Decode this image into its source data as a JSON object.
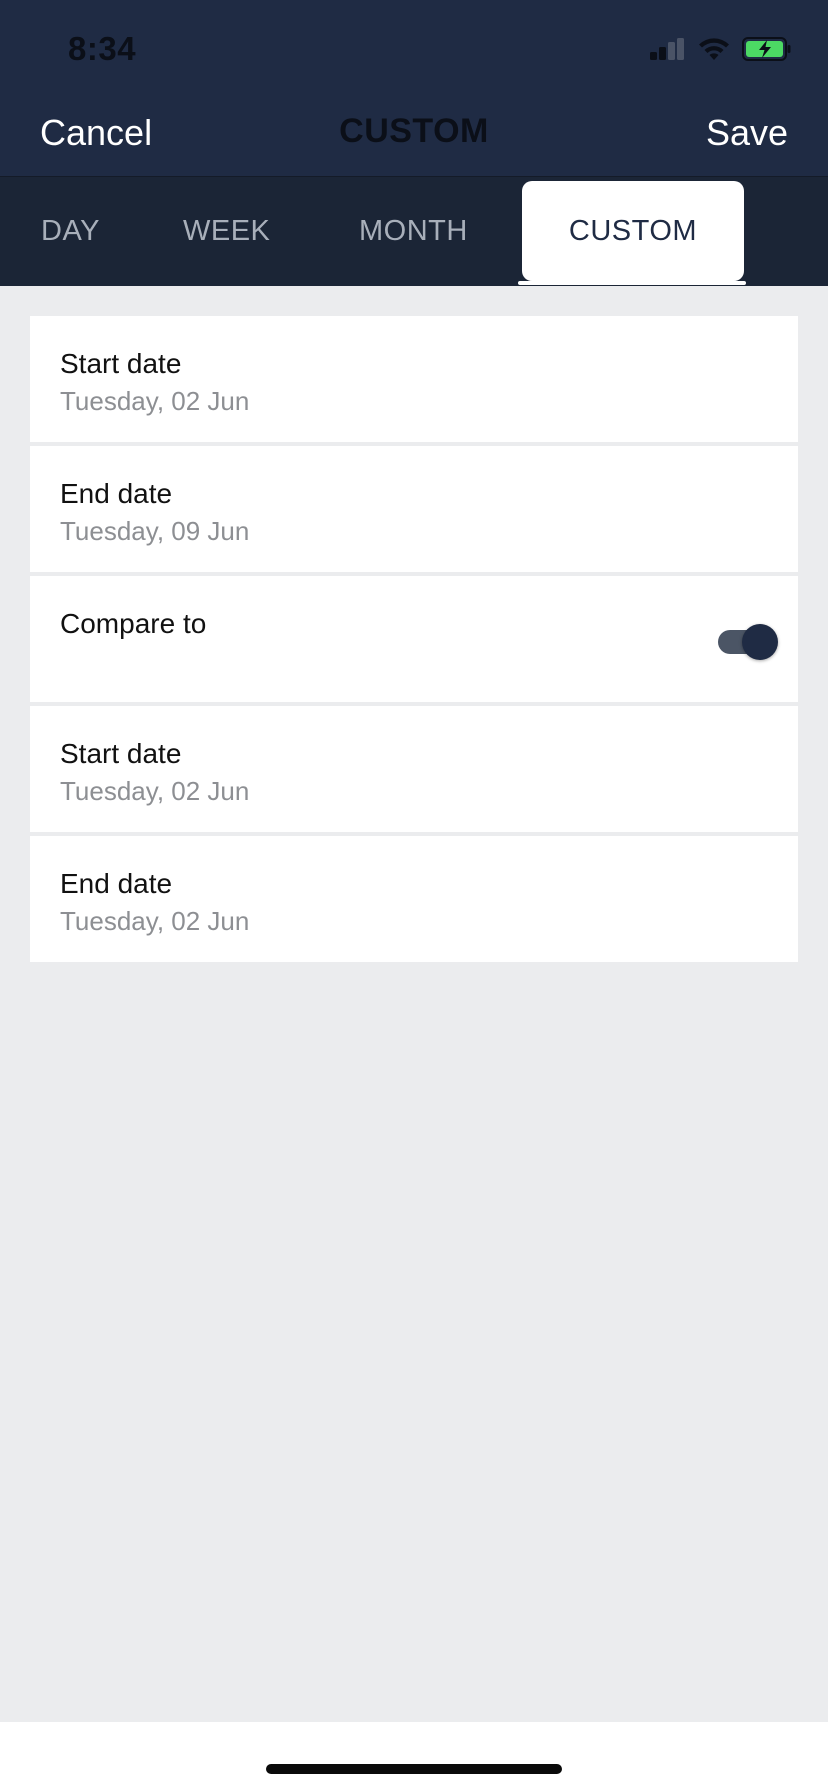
{
  "status": {
    "time": "8:34"
  },
  "nav": {
    "cancel_label": "Cancel",
    "title": "CUSTOM",
    "save_label": "Save"
  },
  "tabs": [
    {
      "label": "DAY",
      "selected": false
    },
    {
      "label": "WEEK",
      "selected": false
    },
    {
      "label": "MONTH",
      "selected": false
    },
    {
      "label": "CUSTOM",
      "selected": true
    }
  ],
  "rows": [
    {
      "title": "Start date",
      "value": "Tuesday, 02 Jun"
    },
    {
      "title": "End date",
      "value": "Tuesday, 09 Jun"
    },
    {
      "title": "Compare to",
      "toggle_on": true
    },
    {
      "title": "Start date",
      "value": "Tuesday, 02 Jun"
    },
    {
      "title": "End date",
      "value": "Tuesday, 02 Jun"
    }
  ],
  "colors": {
    "header_bg": "#1f2b44",
    "tab_bar_bg": "#1b2536",
    "page_bg": "#ebecee",
    "accent": "#1f2b44",
    "battery_green": "#4cd964"
  },
  "icons": [
    "signal-icon",
    "wifi-icon",
    "battery-charging-icon"
  ]
}
